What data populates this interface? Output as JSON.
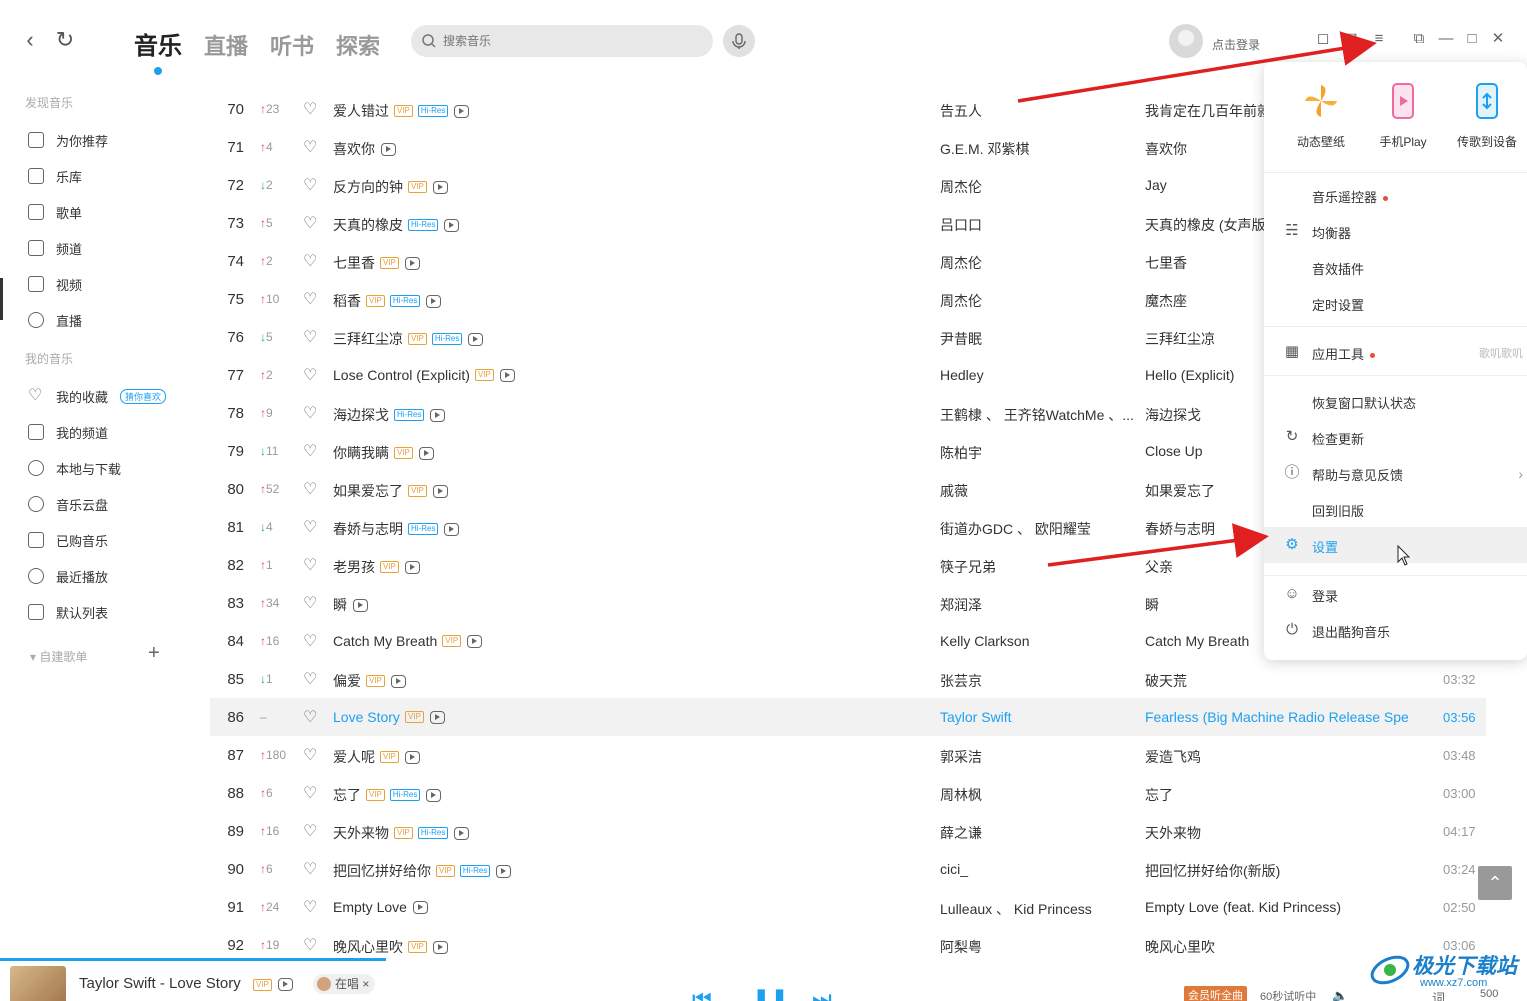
{
  "header": {
    "tabs": [
      "音乐",
      "直播",
      "听书",
      "探索"
    ],
    "search_placeholder": "搜索音乐",
    "login_text": "点击登录"
  },
  "sidebar": {
    "section1": "发现音乐",
    "discover": [
      "为你推荐",
      "乐库",
      "歌单",
      "频道",
      "视频",
      "直播"
    ],
    "section2": "我的音乐",
    "mine": [
      "我的收藏",
      "我的频道",
      "本地与下载",
      "音乐云盘",
      "已购音乐",
      "最近播放",
      "默认列表"
    ],
    "guess_badge": "猜你喜欢",
    "custom_lists": "自建歌单"
  },
  "songs": [
    {
      "n": "70",
      "dir": "up",
      "chg": "23",
      "title": "爱人错过",
      "tags": [
        "VIP",
        "Hi-Res"
      ],
      "artist": "告五人",
      "album": "我肯定在几百年前就说过爱你",
      "dur": ""
    },
    {
      "n": "71",
      "dir": "up",
      "chg": "4",
      "title": "喜欢你",
      "tags": [],
      "artist": "G.E.M. 邓紫棋",
      "album": "喜欢你",
      "dur": ""
    },
    {
      "n": "72",
      "dir": "down",
      "chg": "2",
      "title": "反方向的钟",
      "tags": [
        "VIP"
      ],
      "artist": "周杰伦",
      "album": "Jay",
      "dur": ""
    },
    {
      "n": "73",
      "dir": "up",
      "chg": "5",
      "title": "天真的橡皮",
      "tags": [
        "Hi-Res"
      ],
      "artist": "吕口口",
      "album": "天真的橡皮 (女声版)",
      "dur": ""
    },
    {
      "n": "74",
      "dir": "up",
      "chg": "2",
      "title": "七里香",
      "tags": [
        "VIP"
      ],
      "artist": "周杰伦",
      "album": "七里香",
      "dur": ""
    },
    {
      "n": "75",
      "dir": "up",
      "chg": "10",
      "title": "稻香",
      "tags": [
        "VIP",
        "Hi-Res"
      ],
      "artist": "周杰伦",
      "album": "魔杰座",
      "dur": ""
    },
    {
      "n": "76",
      "dir": "down",
      "chg": "5",
      "title": "三拜红尘凉",
      "tags": [
        "VIP",
        "Hi-Res"
      ],
      "artist": "尹昔眠",
      "album": "三拜红尘凉",
      "dur": ""
    },
    {
      "n": "77",
      "dir": "up",
      "chg": "2",
      "title": "Lose Control (Explicit)",
      "tags": [
        "VIP"
      ],
      "artist": "Hedley",
      "album": "Hello (Explicit)",
      "dur": ""
    },
    {
      "n": "78",
      "dir": "up",
      "chg": "9",
      "title": "海边探戈",
      "tags": [
        "Hi-Res"
      ],
      "artist": "王鹤棣 、 王齐铭WatchMe 、...",
      "album": "海边探戈",
      "dur": ""
    },
    {
      "n": "79",
      "dir": "down",
      "chg": "11",
      "title": "你瞒我瞒",
      "tags": [
        "VIP"
      ],
      "artist": "陈柏宇",
      "album": "Close Up",
      "dur": ""
    },
    {
      "n": "80",
      "dir": "up",
      "chg": "52",
      "title": "如果爱忘了",
      "tags": [
        "VIP"
      ],
      "artist": "戚薇",
      "album": "如果爱忘了",
      "dur": ""
    },
    {
      "n": "81",
      "dir": "down",
      "chg": "4",
      "title": "春娇与志明",
      "tags": [
        "Hi-Res"
      ],
      "artist": "街道办GDC 、 欧阳耀莹",
      "album": "春娇与志明",
      "dur": ""
    },
    {
      "n": "82",
      "dir": "up",
      "chg": "1",
      "title": "老男孩",
      "tags": [
        "VIP"
      ],
      "artist": "筷子兄弟",
      "album": "父亲",
      "dur": ""
    },
    {
      "n": "83",
      "dir": "up",
      "chg": "34",
      "title": "瞬",
      "tags": [],
      "artist": "郑润泽",
      "album": "瞬",
      "dur": ""
    },
    {
      "n": "84",
      "dir": "up",
      "chg": "16",
      "title": "Catch My Breath",
      "tags": [
        "VIP"
      ],
      "artist": "Kelly Clarkson",
      "album": "Catch My Breath",
      "dur": ""
    },
    {
      "n": "85",
      "dir": "down",
      "chg": "1",
      "title": "偏爱",
      "tags": [
        "VIP"
      ],
      "artist": "张芸京",
      "album": "破天荒",
      "dur": "03:32"
    },
    {
      "n": "86",
      "dir": "none",
      "chg": "–",
      "title": "Love Story",
      "tags": [
        "VIP"
      ],
      "artist": "Taylor Swift",
      "album": "Fearless (Big Machine Radio Release Spe...",
      "dur": "03:56",
      "playing": true
    },
    {
      "n": "87",
      "dir": "up",
      "chg": "180",
      "title": "爱人呢",
      "tags": [
        "VIP"
      ],
      "artist": "郭采洁",
      "album": "爱造飞鸡",
      "dur": "03:48"
    },
    {
      "n": "88",
      "dir": "up",
      "chg": "6",
      "title": "忘了",
      "tags": [
        "VIP",
        "Hi-Res"
      ],
      "artist": "周林枫",
      "album": "忘了",
      "dur": "03:00"
    },
    {
      "n": "89",
      "dir": "up",
      "chg": "16",
      "title": "天外来物",
      "tags": [
        "VIP",
        "Hi-Res"
      ],
      "artist": "薛之谦",
      "album": "天外来物",
      "dur": "04:17"
    },
    {
      "n": "90",
      "dir": "up",
      "chg": "6",
      "title": "把回忆拼好给你",
      "tags": [
        "VIP",
        "Hi-Res"
      ],
      "artist": "cici_",
      "album": "把回忆拼好给你(新版)",
      "dur": "03:24"
    },
    {
      "n": "91",
      "dir": "up",
      "chg": "24",
      "title": "Empty Love",
      "tags": [],
      "artist": "Lulleaux 、 Kid Princess",
      "album": "Empty Love (feat. Kid Princess)",
      "dur": "02:50"
    },
    {
      "n": "92",
      "dir": "up",
      "chg": "19",
      "title": "晚风心里吹",
      "tags": [
        "VIP"
      ],
      "artist": "阿梨粤",
      "album": "晚风心里吹",
      "dur": "03:06"
    }
  ],
  "menu": {
    "top": [
      "动态壁纸",
      "手机Play",
      "传歌到设备"
    ],
    "group1": [
      "音乐遥控器",
      "均衡器",
      "音效插件",
      "定时设置"
    ],
    "tools": "应用工具",
    "tools_right": "歌叽歌叽",
    "group3": [
      "恢复窗口默认状态",
      "检查更新",
      "帮助与意见反馈",
      "回到旧版",
      "设置"
    ],
    "group4": [
      "登录",
      "退出酷狗音乐"
    ]
  },
  "player": {
    "now_playing": "Taylor Swift - Love Story",
    "vip_tag": "VIP",
    "singing": "在唱",
    "vip_btn": "会员听全曲",
    "trial": "60秒试听中",
    "lyric": "词",
    "count": "500"
  },
  "watermark": {
    "title": "极光下载站",
    "url": "www.xz7.com"
  },
  "colors": {
    "accent": "#1ea0ef",
    "up": "#e0483e",
    "down": "#2aa86a",
    "vip": "#e6a23c",
    "annotation": "#e02020"
  }
}
